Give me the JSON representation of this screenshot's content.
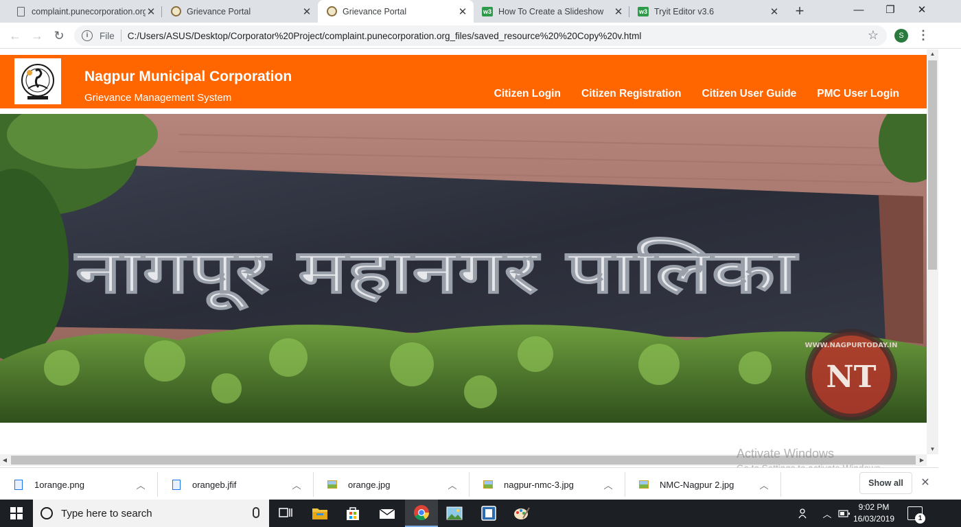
{
  "browser": {
    "tabs": [
      {
        "title": "complaint.punecorporation.org",
        "icon": "document-icon",
        "active": false
      },
      {
        "title": "Grievance Portal",
        "icon": "emblem-icon",
        "active": false
      },
      {
        "title": "Grievance Portal",
        "icon": "emblem-icon",
        "active": true
      },
      {
        "title": "How To Create a Slideshow",
        "icon": "w3-icon",
        "active": false
      },
      {
        "title": "Tryit Editor v3.6",
        "icon": "w3-icon",
        "active": false
      }
    ],
    "new_tab": "+",
    "window_controls": {
      "minimize": "—",
      "maximize": "❐",
      "close": "✕"
    },
    "address_bar": {
      "scheme_label": "File",
      "url": "C:/Users/ASUS/Desktop/Corporator%20Project/complaint.punecorporation.org_files/saved_resource%20%20Copy%20v.html"
    },
    "profile_initial": "S"
  },
  "site": {
    "title": "Nagpur Municipal Corporation",
    "subtitle": "Grievance Management System",
    "nav": [
      "Citizen Login",
      "Citizen Registration",
      "Citizen User Guide",
      "PMC User Login"
    ],
    "banner": {
      "sign_text": "नागपूर महानगर पालिका",
      "watermark_top": "WWW.NAGPURTODAY.IN",
      "watermark_mark": "NT"
    },
    "header_color": "#ff6600"
  },
  "activation": {
    "line1": "Activate Windows",
    "line2": "Go to Settings to activate Windows."
  },
  "downloads": {
    "items": [
      {
        "name": "1orange.png",
        "type": "png"
      },
      {
        "name": "orangeb.jfif",
        "type": "png"
      },
      {
        "name": "orange.jpg",
        "type": "jpg"
      },
      {
        "name": "nagpur-nmc-3.jpg",
        "type": "jpg"
      },
      {
        "name": "NMC-Nagpur 2.jpg",
        "type": "jpg"
      }
    ],
    "show_all": "Show all"
  },
  "taskbar": {
    "search_placeholder": "Type here to search",
    "apps": [
      "task-view-icon",
      "file-explorer-icon",
      "store-icon",
      "mail-icon",
      "chrome-icon",
      "photos-icon",
      "editor-icon",
      "paint-icon"
    ],
    "time": "9:02 PM",
    "date": "16/03/2019",
    "notification_count": "1"
  }
}
